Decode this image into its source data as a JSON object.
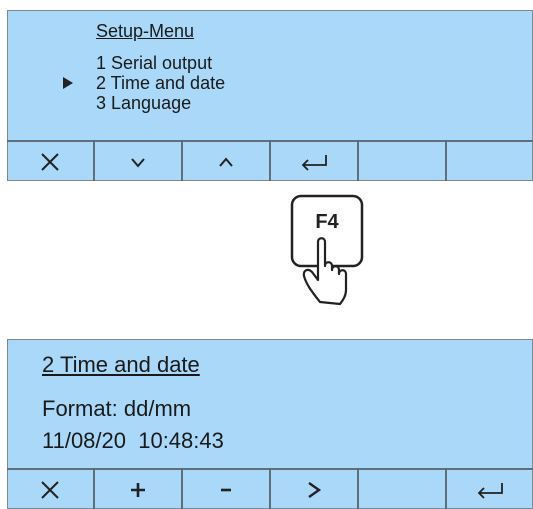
{
  "screen1": {
    "title": "Setup-Menu",
    "items": [
      "1 Serial output",
      "2 Time and date",
      "3 Language"
    ],
    "selected_index": 1,
    "softkeys": [
      "close-icon",
      "chevron-down-icon",
      "chevron-up-icon",
      "enter-icon",
      "",
      ""
    ]
  },
  "key": {
    "label": "F4",
    "icon": "pointing-hand-icon"
  },
  "screen2": {
    "title": "2 Time and date",
    "format": "Format: dd/mm",
    "datetime": "11/08/20  10:48:43",
    "softkeys": [
      "close-icon",
      "plus-icon",
      "minus-icon",
      "next-icon",
      "",
      "enter-icon"
    ]
  },
  "colors": {
    "lcd_background": "#a9d8f8",
    "text": "#1a1a1a"
  }
}
